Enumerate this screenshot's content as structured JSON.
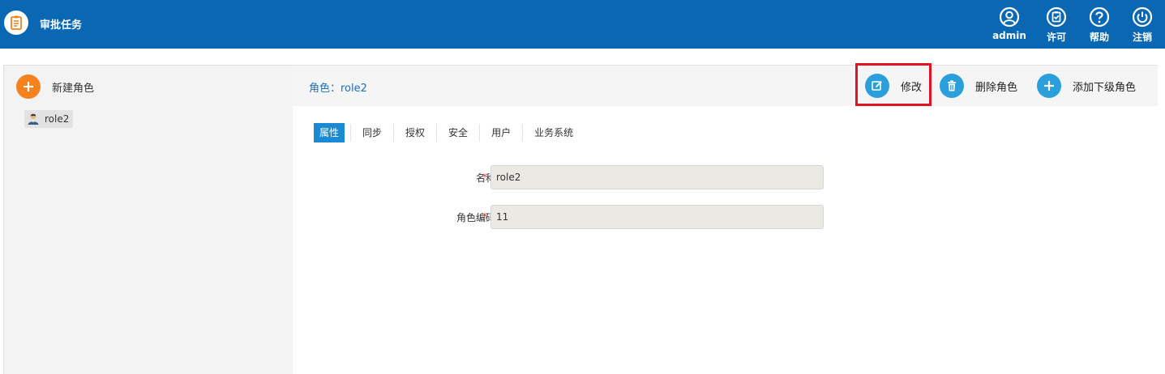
{
  "app": {
    "title": "审批任务",
    "icon": "clipboard-list-icon"
  },
  "top_actions": [
    {
      "label": "admin",
      "icon": "user-circle-icon"
    },
    {
      "label": "许可",
      "icon": "license-clipboard-icon"
    },
    {
      "label": "帮助",
      "icon": "help-question-icon"
    },
    {
      "label": "注销",
      "icon": "power-icon"
    }
  ],
  "sidebar": {
    "new_role_label": "新建角色",
    "new_role_icon": "plus-icon",
    "tree": [
      {
        "label": "role2",
        "icon": "user-role-icon",
        "selected": true
      }
    ]
  },
  "main": {
    "breadcrumb": "角色：role2",
    "actions": {
      "edit": {
        "label": "修改",
        "icon": "edit-icon"
      },
      "delete": {
        "label": "删除角色",
        "icon": "trash-icon"
      },
      "add_child": {
        "label": "添加下级角色",
        "icon": "plus-icon"
      }
    },
    "tabs": [
      {
        "label": "属性",
        "active": true
      },
      {
        "label": "同步",
        "active": false
      },
      {
        "label": "授权",
        "active": false
      },
      {
        "label": "安全",
        "active": false
      },
      {
        "label": "用户",
        "active": false
      },
      {
        "label": "业务系统",
        "active": false
      }
    ],
    "form": {
      "name": {
        "label": "名称",
        "value": "role2",
        "required": true
      },
      "code": {
        "label": "角色编码",
        "value": "11",
        "required": true
      },
      "required_mark": "*"
    }
  },
  "colors": {
    "topbar": "#0a67b4",
    "accent_blue": "#2a9fdc",
    "accent_orange": "#f5821f",
    "highlight_red": "#e0141e",
    "tab_active": "#1a8ad4"
  }
}
